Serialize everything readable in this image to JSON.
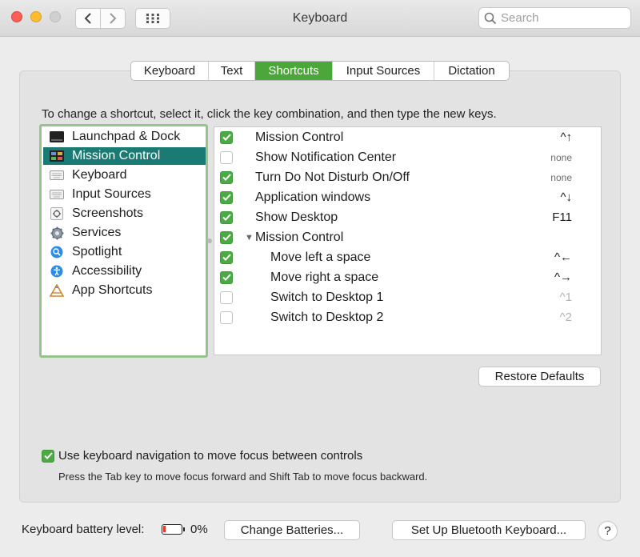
{
  "window": {
    "title": "Keyboard",
    "search_placeholder": "Search"
  },
  "tabs": [
    {
      "label": "Keyboard",
      "active": false
    },
    {
      "label": "Text",
      "active": false
    },
    {
      "label": "Shortcuts",
      "active": true
    },
    {
      "label": "Input Sources",
      "active": false
    },
    {
      "label": "Dictation",
      "active": false
    }
  ],
  "instructions": "To change a shortcut, select it, click the key combination, and then type the new keys.",
  "categories": [
    {
      "label": "Launchpad & Dock",
      "icon": "launchpad-dock-icon",
      "selected": false
    },
    {
      "label": "Mission Control",
      "icon": "mission-control-icon",
      "selected": true
    },
    {
      "label": "Keyboard",
      "icon": "keyboard-icon",
      "selected": false
    },
    {
      "label": "Input Sources",
      "icon": "keyboard-icon",
      "selected": false
    },
    {
      "label": "Screenshots",
      "icon": "screenshot-icon",
      "selected": false
    },
    {
      "label": "Services",
      "icon": "gear-icon",
      "selected": false
    },
    {
      "label": "Spotlight",
      "icon": "spotlight-icon",
      "selected": false
    },
    {
      "label": "Accessibility",
      "icon": "accessibility-icon",
      "selected": false
    },
    {
      "label": "App Shortcuts",
      "icon": "app-shortcuts-icon",
      "selected": false
    }
  ],
  "shortcuts": [
    {
      "label": "Mission Control",
      "key": "^↑",
      "checked": true,
      "indent": false,
      "group": false,
      "key_style": "normal"
    },
    {
      "label": "Show Notification Center",
      "key": "none",
      "checked": false,
      "indent": false,
      "group": false,
      "key_style": "small"
    },
    {
      "label": "Turn Do Not Disturb On/Off",
      "key": "none",
      "checked": true,
      "indent": false,
      "group": false,
      "key_style": "small"
    },
    {
      "label": "Application windows",
      "key": "^↓",
      "checked": true,
      "indent": false,
      "group": false,
      "key_style": "normal"
    },
    {
      "label": "Show Desktop",
      "key": "F11",
      "checked": true,
      "indent": false,
      "group": false,
      "key_style": "normal"
    },
    {
      "label": "Mission Control",
      "key": "",
      "checked": true,
      "indent": false,
      "group": true,
      "key_style": "normal"
    },
    {
      "label": "Move left a space",
      "key": "^←",
      "checked": true,
      "indent": true,
      "group": false,
      "key_style": "normal"
    },
    {
      "label": "Move right a space",
      "key": "^→",
      "checked": true,
      "indent": true,
      "group": false,
      "key_style": "normal"
    },
    {
      "label": "Switch to Desktop 1",
      "key": "^1",
      "checked": false,
      "indent": true,
      "group": false,
      "key_style": "dim"
    },
    {
      "label": "Switch to Desktop 2",
      "key": "^2",
      "checked": false,
      "indent": true,
      "group": false,
      "key_style": "dim"
    }
  ],
  "buttons": {
    "restore_defaults": "Restore Defaults",
    "change_batteries": "Change Batteries...",
    "setup_bluetooth": "Set Up Bluetooth Keyboard...",
    "help": "?"
  },
  "keyboard_navigation": {
    "checked": true,
    "label": "Use keyboard navigation to move focus between controls",
    "hint": "Press the Tab key to move focus forward and Shift Tab to move focus backward."
  },
  "battery": {
    "label": "Keyboard battery level:",
    "percent": "0%",
    "level": 0.0
  },
  "colors": {
    "accent": "#4ca63a",
    "selection": "#1a7a74",
    "checkbox": "#4caa45",
    "battery_low": "#e53a2e"
  }
}
